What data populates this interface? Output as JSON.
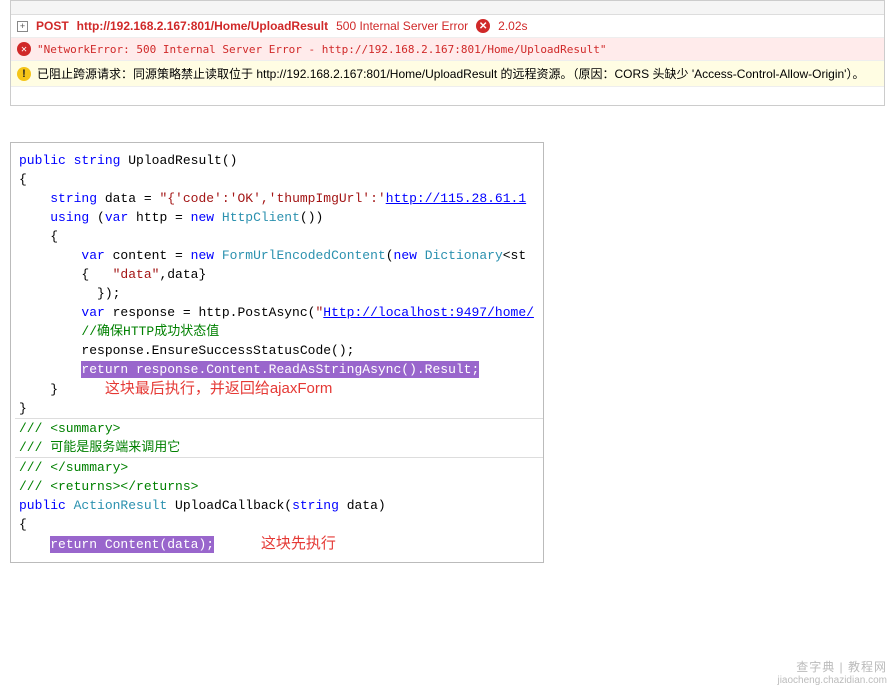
{
  "console": {
    "request": {
      "method": "POST",
      "url": "http://192.168.2.167:801/Home/UploadResult",
      "status": "500 Internal Server Error",
      "duration": "2.02s",
      "expand_symbol": "+"
    },
    "network_error": "\"NetworkError: 500 Internal Server Error - http://192.168.2.167:801/Home/UploadResult\"",
    "cors_warning": "已阻止跨源请求：同源策略禁止读取位于 http://192.168.2.167:801/Home/UploadResult 的远程资源。（原因：CORS 头缺少 'Access-Control-Allow-Origin'）。",
    "error_glyph": "✕",
    "warn_glyph": "!"
  },
  "code": {
    "l1_kw1": "public",
    "l1_kw2": "string",
    "l1_name": " UploadResult()",
    "l2": "{",
    "l3_kw": "string",
    "l3_rest": " data = ",
    "l3_str1": "\"{'code':'OK','thumpImgUrl':'",
    "l3_link": "http://115.28.61.1",
    "l4": "",
    "l5_kw1": "using",
    "l5_rest1": " (",
    "l5_kw2": "var",
    "l5_rest2": " http = ",
    "l5_kw3": "new",
    "l5_rest3": " ",
    "l5_type": "HttpClient",
    "l5_rest4": "())",
    "l6": "    {",
    "l7_kw1": "var",
    "l7_rest1": " content = ",
    "l7_kw2": "new",
    "l7_rest2": " ",
    "l7_type1": "FormUrlEncodedContent",
    "l7_rest3": "(",
    "l7_kw3": "new",
    "l7_rest4": " ",
    "l7_type2": "Dictionary",
    "l7_rest5": "<st",
    "l8_rest1": "        {   ",
    "l8_str": "\"data\"",
    "l8_rest2": ",data}",
    "l9": "          });",
    "l10_kw": "var",
    "l10_rest1": " response = http.PostAsync(",
    "l10_str": "\"",
    "l10_link": "Http://localhost:9497/home/",
    "l11_cmt": "//确保HTTP成功状态值",
    "l12": "        response.EnsureSuccessStatusCode();",
    "l13": "",
    "l14_hl": "return response.Content.ReadAsStringAsync().Result;",
    "l15": "",
    "l16": "    }",
    "anno1": "这块最后执行，并返回给ajaxForm",
    "l17": "",
    "l18": "}",
    "l19": "",
    "c1": "/// <summary>",
    "c2_pre": "/// ",
    "c2_txt": "可能是服务端来调用它",
    "c3": "/// </summary>",
    "c4": "/// <returns></returns>",
    "l20_kw1": "public",
    "l20_rest1": " ",
    "l20_type": "ActionResult",
    "l20_rest2": " UploadCallback(",
    "l20_kw2": "string",
    "l20_rest3": " data)",
    "l21": "{",
    "l22_hl": "return Content(data);",
    "anno2": "这块先执行"
  },
  "watermark": {
    "line1": "查字典 | 教程网",
    "line2": "jiaocheng.chazidian.com"
  }
}
